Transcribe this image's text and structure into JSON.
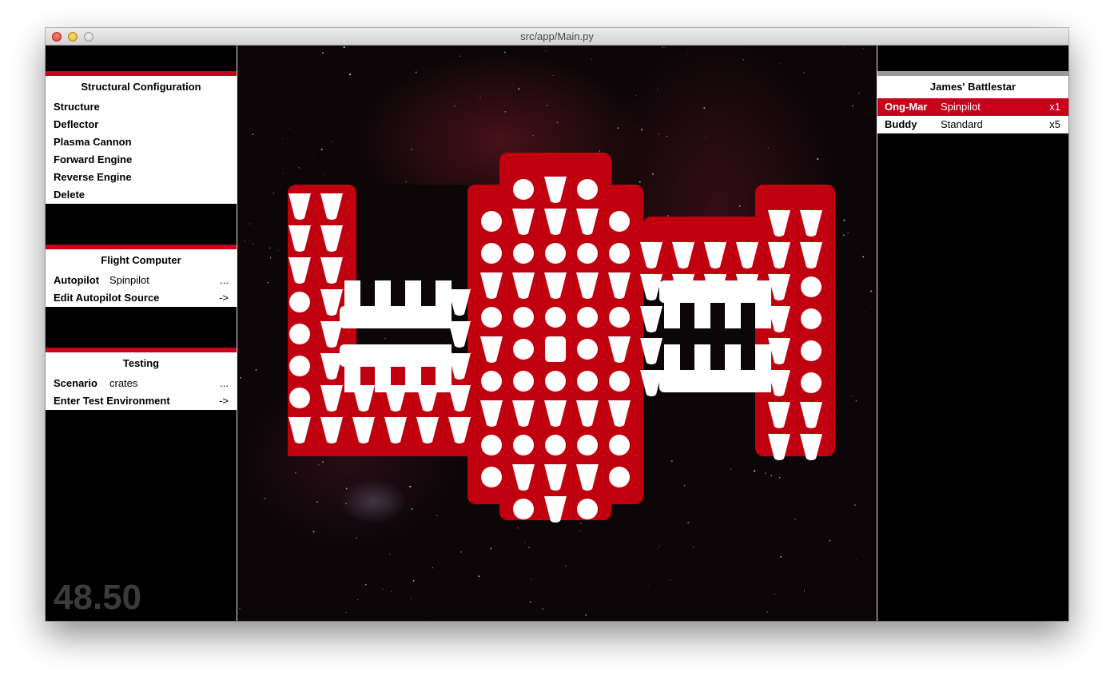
{
  "window": {
    "title": "src/app/Main.py"
  },
  "structural": {
    "title": "Structural Configuration",
    "items": [
      "Structure",
      "Deflector",
      "Plasma Cannon",
      "Forward Engine",
      "Reverse Engine",
      "Delete"
    ]
  },
  "flight": {
    "title": "Flight Computer",
    "autopilot_label": "Autopilot",
    "autopilot_value": "Spinpilot",
    "autopilot_more": "...",
    "edit_label": "Edit Autopilot Source",
    "edit_arrow": "->"
  },
  "testing": {
    "title": "Testing",
    "scenario_label": "Scenario",
    "scenario_value": "crates",
    "scenario_more": "...",
    "enter_label": "Enter Test Environment",
    "enter_arrow": "->"
  },
  "fps": "48.50",
  "fleet": {
    "title": "James' Battlestar",
    "ships": [
      {
        "name": "Ong-Mar",
        "pilot": "Spinpilot",
        "count": "x1",
        "selected": true
      },
      {
        "name": "Buddy",
        "pilot": "Standard",
        "count": "x5",
        "selected": false
      }
    ]
  },
  "colors": {
    "accent": "#c8001a",
    "hull": "#c0000f",
    "module": "#ffffff"
  },
  "ship": {
    "hull_rows": [
      "XX####XXXXX##XXXXXXXX",
      "XX####XXXXXXXXXXXXXXX",
      "XX####XXXXXXXXXXXXXXX",
      "XXXXXXXXXXXXXXXXXXXXX",
      "XXXXXXXXXXXXXXXXXXXXX",
      "XXXXXXXXXXXXXXXXXXXXX",
      "XXXXXXXXXXXXX####XXXX",
      "XXXXXXXXXXXXX####XXXX",
      "#####XXXXX#######XXXX",
      "#######XXX###########"
    ],
    "module_rows": [
      "..##.....OVO..........",
      "VV..#OVVVO.......VV.",
      "VV..#OOOOOVVVVVV.",
      "VV...VVVVVVVVVVO",
      "OV...OOOVOVV...VO",
      "OV...VVOSOVVV...VO",
      "OV...OOOOOV...VO",
      "OVVVVVVVVVV...VV",
      "VVVVVVVVOOOO.VV",
      "..OVVV........",
      "..OVO........."
    ]
  }
}
